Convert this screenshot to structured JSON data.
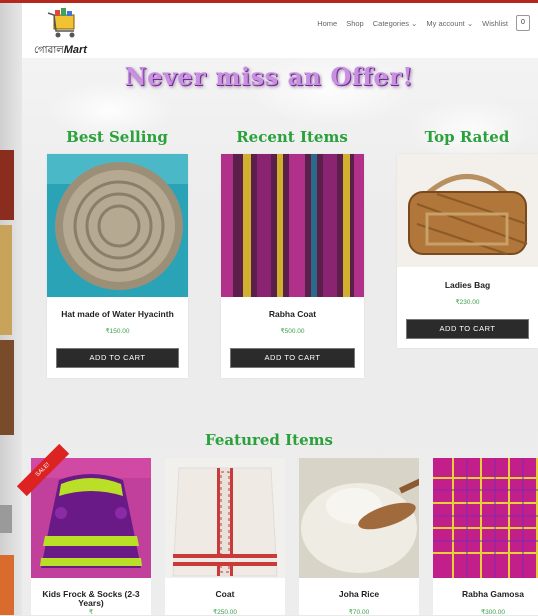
{
  "header": {
    "logo_text_prefix": "গোৱাল",
    "logo_text_suffix": "Mart",
    "nav": [
      "Home",
      "Shop",
      "Categories",
      "My account",
      "Wishlist"
    ],
    "dropdown_glyph": "⌄",
    "cart_count": "0"
  },
  "hero": {
    "title": "Never miss an Offer!"
  },
  "sections": {
    "best_selling": {
      "title": "Best Selling",
      "product": {
        "name": "Hat made of Water Hyacinth",
        "price": "₹150.00",
        "button": "ADD TO CART"
      }
    },
    "recent_items": {
      "title": "Recent Items",
      "product": {
        "name": "Rabha Coat",
        "price": "₹500.00",
        "button": "ADD TO CART"
      }
    },
    "top_rated": {
      "title": "Top Rated",
      "product": {
        "name": "Ladies Bag",
        "price": "₹230.00",
        "button": "ADD TO CART"
      }
    }
  },
  "featured": {
    "title": "Featured Items",
    "items": [
      {
        "name": "Kids Frock & Socks (2-3 Years)",
        "price": "₹",
        "badge": "SALE!"
      },
      {
        "name": "Coat",
        "price": "₹250.00"
      },
      {
        "name": "Joha Rice",
        "price": "₹70.00"
      },
      {
        "name": "Rabha Gamosa",
        "price": "₹300.00"
      }
    ]
  }
}
